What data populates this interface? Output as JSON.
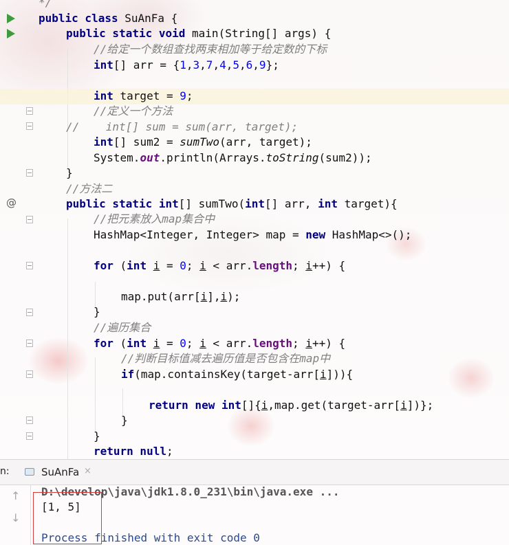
{
  "editor": {
    "lines": [
      {
        "row": 0,
        "indent": 1,
        "code": "*/",
        "kind": "comment-end"
      },
      {
        "row": 1,
        "text": "public class SuAnFa {"
      },
      {
        "row": 2,
        "text": "public static void main(String[] args) {"
      },
      {
        "row": 3,
        "text": "//给定一个数组查找两束相加等于给定数的下标"
      },
      {
        "row": 4,
        "text": "int[] arr = {1,3,7,4,5,6,9};"
      },
      {
        "row": 5,
        "text": ""
      },
      {
        "row": 6,
        "text": "int target = 9;"
      },
      {
        "row": 7,
        "text": "//定义一个方法"
      },
      {
        "row": 8,
        "text": "//    int[] sum = sum(arr, target);"
      },
      {
        "row": 9,
        "text": "int[] sum2 = sumTwo(arr, target);"
      },
      {
        "row": 10,
        "text": "System.out.println(Arrays.toString(sum2));"
      },
      {
        "row": 11,
        "text": "}"
      },
      {
        "row": 12,
        "text": "//方法二"
      },
      {
        "row": 13,
        "text": "public static int[] sumTwo(int[] arr, int target){"
      },
      {
        "row": 14,
        "text": "//把元素放入map集合中"
      },
      {
        "row": 15,
        "text": "HashMap<Integer, Integer> map = new HashMap<>();"
      },
      {
        "row": 16,
        "text": ""
      },
      {
        "row": 17,
        "text": "for (int i = 0; i < arr.length; i++) {"
      },
      {
        "row": 18,
        "text": ""
      },
      {
        "row": 19,
        "text": "map.put(arr[i],i);"
      },
      {
        "row": 20,
        "text": "}"
      },
      {
        "row": 21,
        "text": "//遍历集合"
      },
      {
        "row": 22,
        "text": "for (int i = 0; i < arr.length; i++) {"
      },
      {
        "row": 23,
        "text": "//判断目标值减去遍历值是否包含在map中"
      },
      {
        "row": 24,
        "text": "if(map.containsKey(target-arr[i])){"
      },
      {
        "row": 25,
        "text": ""
      },
      {
        "row": 26,
        "text": "return new int[]{i,map.get(target-arr[i])};"
      },
      {
        "row": 27,
        "text": "}"
      },
      {
        "row": 28,
        "text": "}"
      },
      {
        "row": 29,
        "text": "return null;"
      }
    ]
  },
  "run_panel": {
    "label": "n:",
    "tab_label": "SuAnFa",
    "tab_close": "×",
    "up_arrow": "↑",
    "down_arrow": "↓",
    "command": "D:\\develop\\java\\jdk1.8.0_231\\bin\\java.exe ...",
    "output": "[1, 5]",
    "exit_message": "Process finished with exit code 0"
  },
  "gutter_icons": {
    "run": "run-arrow-icon",
    "override": "@"
  },
  "colors": {
    "keyword": "#000080",
    "number": "#0000ff",
    "comment": "#808080",
    "static_field": "#660e7a",
    "highlight_border": "#d23b3b",
    "current_line": "#faf3d7"
  }
}
